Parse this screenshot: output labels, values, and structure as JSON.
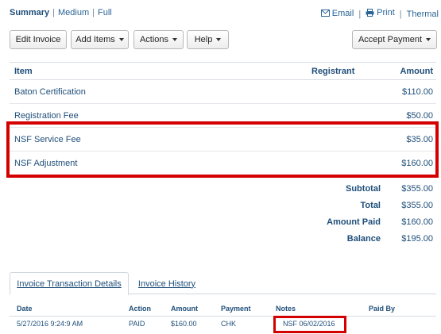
{
  "header": {
    "views": {
      "summary": "Summary",
      "medium": "Medium",
      "full": "Full",
      "sep": "|"
    },
    "outputs": {
      "email": "Email",
      "print": "Print",
      "thermal": "Thermal",
      "sep": "|"
    }
  },
  "toolbar": {
    "edit_invoice": "Edit Invoice",
    "add_items": "Add Items",
    "actions": "Actions",
    "help": "Help",
    "accept_payment": "Accept Payment"
  },
  "items_table": {
    "columns": {
      "item": "Item",
      "registrant": "Registrant",
      "amount": "Amount"
    },
    "rows": [
      {
        "item": "Baton Certification",
        "registrant": "",
        "amount": "$110.00"
      },
      {
        "item": "Registration Fee",
        "registrant": "",
        "amount": "$50.00"
      },
      {
        "item": "NSF Service Fee",
        "registrant": "",
        "amount": "$35.00"
      },
      {
        "item": "NSF Adjustment",
        "registrant": "",
        "amount": "$160.00"
      }
    ]
  },
  "totals": [
    {
      "label": "Subtotal",
      "value": "$355.00"
    },
    {
      "label": "Total",
      "value": "$355.00"
    },
    {
      "label": "Amount Paid",
      "value": "$160.00"
    },
    {
      "label": "Balance",
      "value": "$195.00"
    }
  ],
  "tabs": {
    "transactions": "Invoice Transaction Details",
    "history": "Invoice History"
  },
  "transactions": {
    "columns": {
      "date": "Date",
      "action": "Action",
      "amount": "Amount",
      "payment": "Payment",
      "notes": "Notes",
      "paid_by": "Paid By"
    },
    "rows": [
      {
        "date": "5/27/2016 9:24:9 AM",
        "action": "PAID",
        "amount": "$160.00",
        "payment": "CHK",
        "notes": "NSF 06/02/2016",
        "paid_by": ""
      }
    ]
  },
  "colors": {
    "highlight": "#d40000",
    "text": "#1f4e79",
    "link": "#2a6496"
  }
}
